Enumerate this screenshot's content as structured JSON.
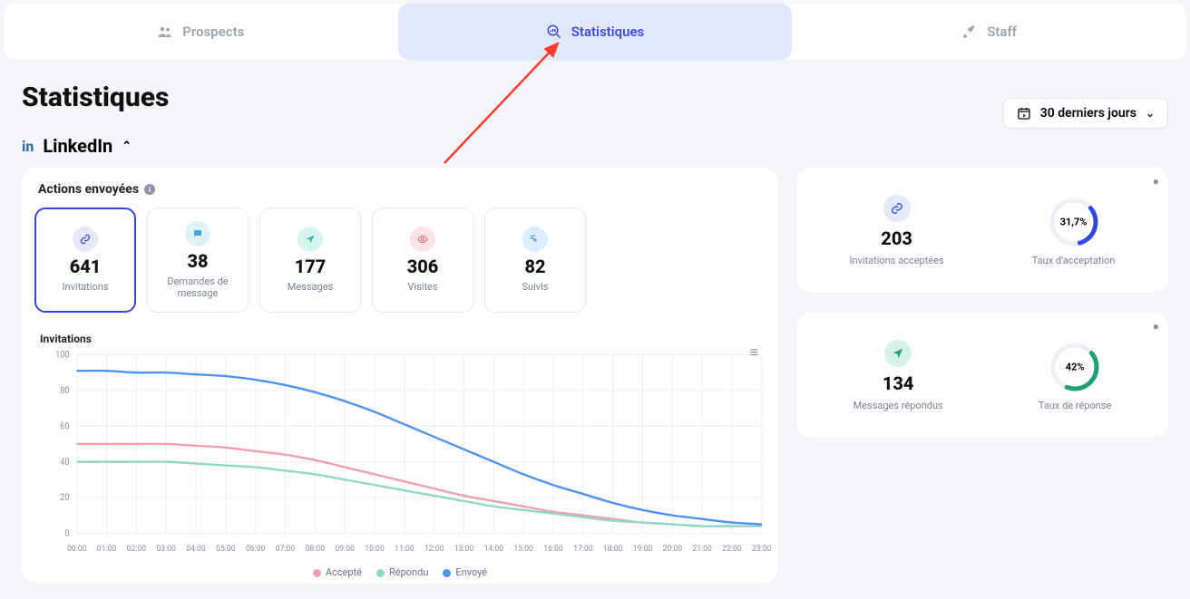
{
  "tabs": {
    "prospects": "Prospects",
    "stats": "Statistiques",
    "staff": "Staff"
  },
  "page_title": "Statistiques",
  "range": "30 derniers jours",
  "section_title": "LinkedIn",
  "actions_title": "Actions envoyées",
  "cards": [
    {
      "value": "641",
      "label": "Invitations",
      "active": true
    },
    {
      "value": "38",
      "label": "Demandes de message"
    },
    {
      "value": "177",
      "label": "Messages"
    },
    {
      "value": "306",
      "label": "Visites"
    },
    {
      "value": "82",
      "label": "Suivis"
    }
  ],
  "chart_data": {
    "type": "line",
    "title": "Invitations",
    "xlabel": "",
    "ylabel": "",
    "ylim": [
      0,
      100
    ],
    "yticks": [
      0,
      20,
      40,
      60,
      80,
      100
    ],
    "categories": [
      "00:00",
      "01:00",
      "02:00",
      "03:00",
      "04:00",
      "05:00",
      "06:00",
      "07:00",
      "08:00",
      "09:00",
      "10:00",
      "11:00",
      "12:00",
      "13:00",
      "14:00",
      "15:00",
      "16:00",
      "17:00",
      "18:00",
      "19:00",
      "20:00",
      "21:00",
      "22:00",
      "23:00"
    ],
    "series": [
      {
        "name": "Accepté",
        "color": "#f1a0ae",
        "values": [
          50,
          50,
          50,
          50,
          49,
          48,
          46,
          44,
          41,
          37,
          33,
          29,
          25,
          21,
          18,
          15,
          12,
          10,
          8,
          6,
          5,
          4,
          4,
          4
        ]
      },
      {
        "name": "Répondu",
        "color": "#8fd9c8",
        "values": [
          40,
          40,
          40,
          40,
          39,
          38,
          37,
          35,
          33,
          30,
          27,
          24,
          21,
          18,
          15,
          13,
          11,
          9,
          7,
          6,
          5,
          4,
          4,
          4
        ]
      },
      {
        "name": "Envoyé",
        "color": "#4d94f0",
        "values": [
          91,
          91,
          90,
          90,
          89,
          88,
          86,
          83,
          79,
          74,
          68,
          61,
          54,
          47,
          40,
          33,
          27,
          22,
          17,
          13,
          10,
          8,
          6,
          5
        ]
      }
    ],
    "legend": {
      "accepte": "Accepté",
      "repondu": "Répondu",
      "envoye": "Envoyé"
    }
  },
  "side": {
    "accept": {
      "value": "203",
      "label": "Invitations acceptées",
      "rate": "31,7%",
      "rate_label": "Taux d'acceptation",
      "rate_num": 31.7,
      "color": "#2f49e3"
    },
    "reply": {
      "value": "134",
      "label": "Messages répondus",
      "rate": "42%",
      "rate_label": "Taux de réponse",
      "rate_num": 42,
      "color": "#1d9f77"
    }
  }
}
